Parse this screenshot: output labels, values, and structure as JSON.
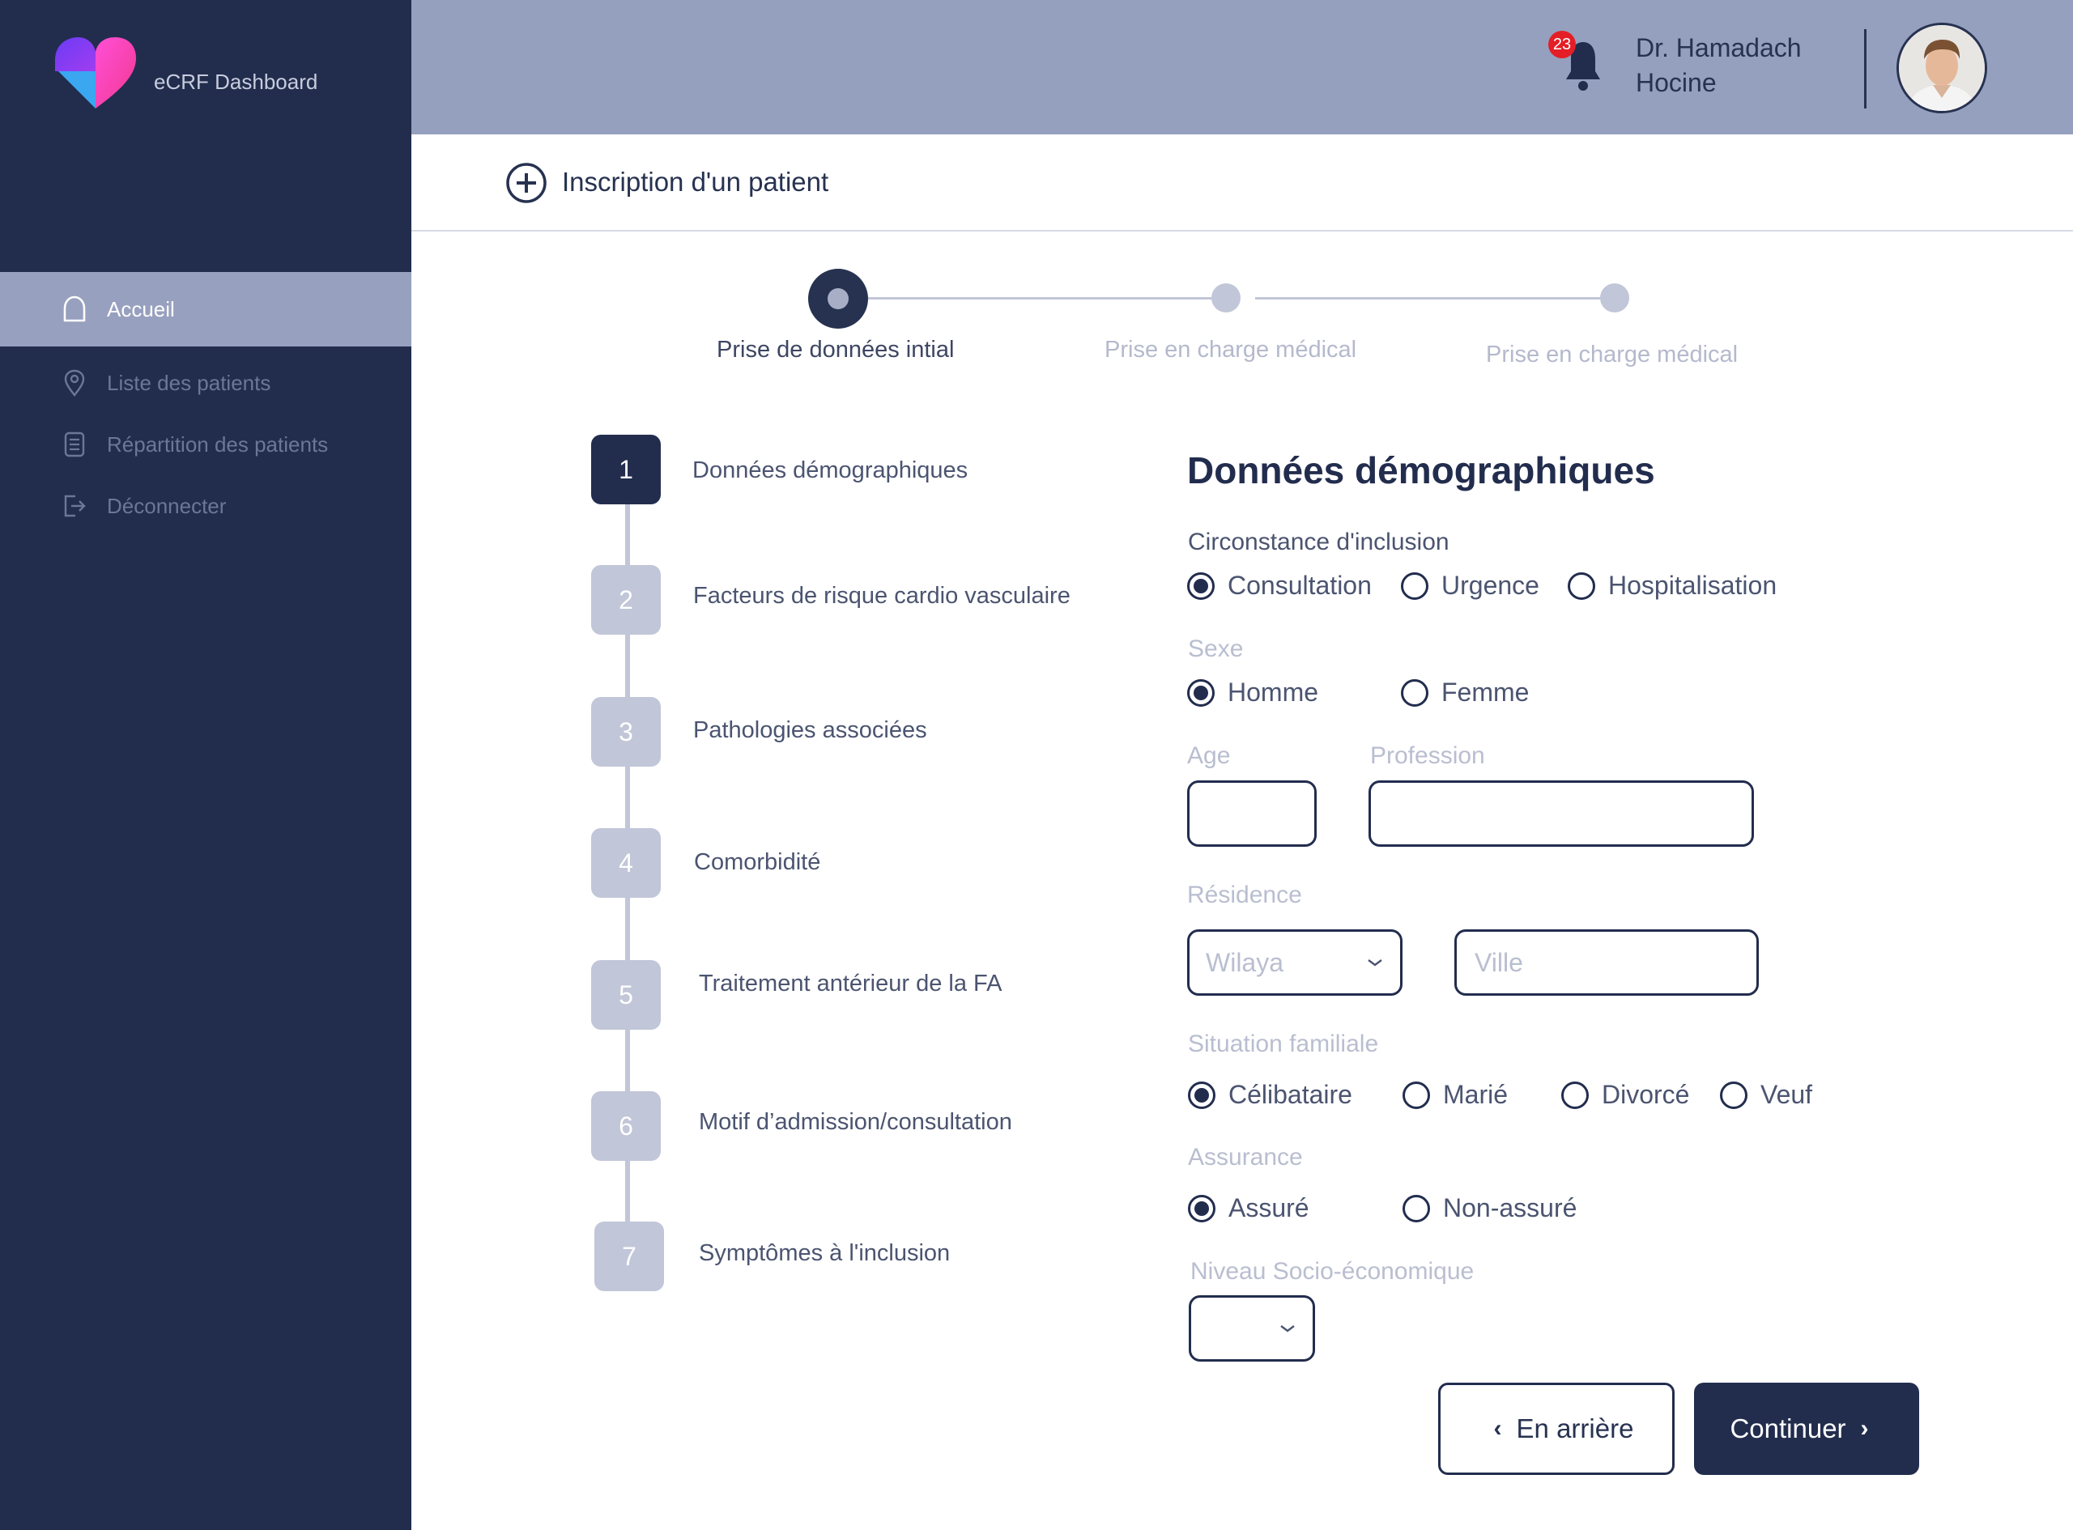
{
  "app": {
    "brand": "eCRF Dashboard"
  },
  "sidebar": {
    "items": [
      {
        "label": "Accueil",
        "icon": "home-icon",
        "active": true
      },
      {
        "label": "Liste des patients",
        "icon": "location-pin-icon",
        "active": false
      },
      {
        "label": "Répartition  des patients",
        "icon": "list-document-icon",
        "active": false
      },
      {
        "label": "Déconnecter",
        "icon": "logout-icon",
        "active": false
      }
    ]
  },
  "header": {
    "notifications": {
      "count": "23",
      "icon": "bell-icon"
    },
    "user": {
      "first_line": "Dr. Hamadach",
      "second_line": "Hocine"
    }
  },
  "page": {
    "title": "Inscription d'un patient",
    "title_icon": "add-circle-icon"
  },
  "stepper": {
    "steps": [
      {
        "label": "Prise de données intial",
        "active": true
      },
      {
        "label": "Prise en charge médical",
        "active": false
      },
      {
        "label": "Prise en charge médical",
        "active": false
      }
    ]
  },
  "sections": [
    {
      "number": "1",
      "label": "Données démographiques",
      "active": true
    },
    {
      "number": "2",
      "label": "Facteurs de risque cardio vasculaire",
      "active": false
    },
    {
      "number": "3",
      "label": "Pathologies associées",
      "active": false
    },
    {
      "number": "4",
      "label": "Comorbidité",
      "active": false
    },
    {
      "number": "5",
      "label": "Traitement antérieur de la FA",
      "active": false
    },
    {
      "number": "6",
      "label": "Motif d’admission/consultation",
      "active": false
    },
    {
      "number": "7",
      "label": "Symptômes à l'inclusion",
      "active": false
    }
  ],
  "form": {
    "title": "Données démographiques",
    "circonstance": {
      "label": "Circonstance d'inclusion",
      "options": [
        "Consultation",
        "Urgence",
        "Hospitalisation"
      ],
      "selected": "Consultation"
    },
    "sexe": {
      "label": "Sexe",
      "options": [
        "Homme",
        "Femme"
      ],
      "selected": "Homme"
    },
    "age": {
      "label": "Age",
      "value": ""
    },
    "profession": {
      "label": "Profession",
      "value": ""
    },
    "residence": {
      "label": "Résidence",
      "wilaya_placeholder": "Wilaya",
      "ville_placeholder": "Ville"
    },
    "situation": {
      "label": "Situation familiale",
      "options": [
        "Célibataire",
        "Marié",
        "Divorcé",
        "Veuf"
      ],
      "selected": "Célibataire"
    },
    "assurance": {
      "label": "Assurance",
      "options": [
        "Assuré",
        "Non-assuré"
      ],
      "selected": "Assuré"
    },
    "niveau": {
      "label": "Niveau Socio-économique",
      "value": ""
    }
  },
  "buttons": {
    "back": "En arrière",
    "next": "Continuer"
  },
  "colors": {
    "navy": "#222d4e",
    "header_bg": "#95a0bf",
    "muted": "#c1c6d8",
    "badge": "#e41e26"
  }
}
